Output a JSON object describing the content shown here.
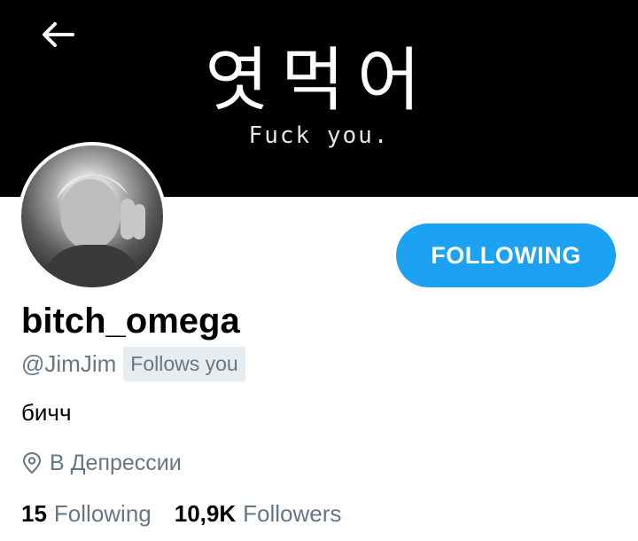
{
  "header": {
    "banner_title": "엿먹어",
    "banner_subtitle": "Fuck you.",
    "back_icon": "arrow-left-icon"
  },
  "profile": {
    "display_name": "bitch_omega",
    "handle": "@JimJim",
    "follows_you_badge": "Follows you",
    "bio": "бичч",
    "location": "В Депрессии",
    "location_icon": "location-pin-icon",
    "follow_button_label": "FOLLOWING"
  },
  "stats": {
    "following_count": "15",
    "following_label": "Following",
    "followers_count": "10,9K",
    "followers_label": "Followers"
  },
  "colors": {
    "accent": "#1da1f2",
    "secondary_text": "#657786",
    "badge_bg": "#e6ecf0",
    "header_bg": "#000000"
  }
}
